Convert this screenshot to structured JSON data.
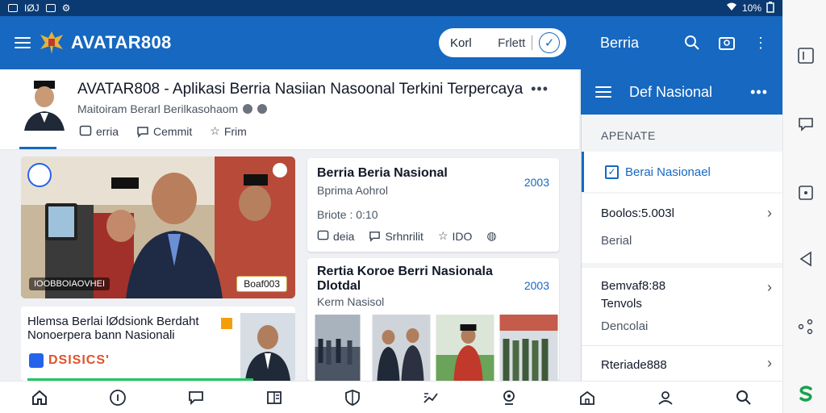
{
  "status_bar": {
    "left_text": "IØJ",
    "right_text": "10%"
  },
  "app_bar": {
    "brand": "AVATAR808",
    "search": {
      "field_1": "Korl",
      "field_2": "Frlett"
    }
  },
  "right_header": {
    "title": "Berria"
  },
  "article": {
    "title": "AVATAR808 - Aplikasi Berria Nasiian Nasoonal Terkini Terpercaya",
    "subtitle": "Maitoiram Berarl Berilkasohaom",
    "actions": [
      "erria",
      "Cemmit",
      "Frim"
    ]
  },
  "feature": {
    "caption": "IOOBBOIAOVHEI",
    "badge": "Boaf003"
  },
  "news2": {
    "headline": "Hlemsa Berlai lØdsionk Berdaht Nonoerpera bann Nasionali",
    "brand": "DSISICS'"
  },
  "card1": {
    "title": "Berria Beria Nasional",
    "number": "2003",
    "author": "Bprima Aohrol",
    "meta": "Briote : 0:10",
    "actions": [
      "deia",
      "Srhnrilit",
      "IDO"
    ]
  },
  "card2": {
    "title": "Rertia Koroe Berri Nasionala Dlotdal",
    "number": "2003",
    "subtitle": "Kerm Nasisol"
  },
  "right_panel": {
    "sub_title": "Def Nasional",
    "section_label": "APENATE",
    "checked_item": "Berai Nasionael",
    "items": [
      {
        "line1": "Boolos:5.003l",
        "line2": "Berial"
      },
      {
        "line1": "Bemvaf8:88",
        "line1b": "Tenvols",
        "line2": "Dencolai"
      },
      {
        "line1": "Rteriade888",
        "line2": ""
      }
    ]
  },
  "colors": {
    "primary": "#1668c0",
    "status_bar": "#0b3a72",
    "accent_orange": "#e0522a"
  },
  "icons": {
    "bottom_nav": [
      "home-icon",
      "info-icon",
      "chat-icon",
      "list-icon",
      "shield-icon",
      "trending-icon",
      "location-icon",
      "building-icon",
      "profile-icon",
      "search-icon"
    ],
    "system_nav": [
      "window-icon",
      "chat-bubble-icon",
      "square-icon",
      "back-triangle-icon",
      "share-icon",
      "s-logo-icon"
    ]
  }
}
